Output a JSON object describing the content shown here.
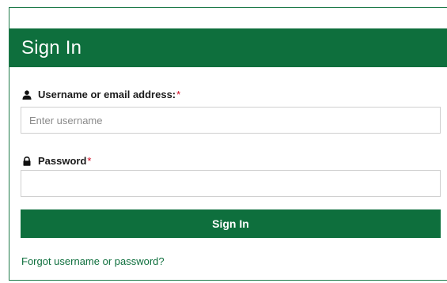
{
  "header": {
    "title": "Sign In"
  },
  "username": {
    "label": "Username or email address:",
    "required_marker": "*",
    "placeholder": "Enter username",
    "value": "",
    "icon": "user-icon"
  },
  "password": {
    "label": "Password",
    "required_marker": "*",
    "placeholder": "",
    "value": "",
    "icon": "lock-icon"
  },
  "actions": {
    "signin_label": "Sign In",
    "forgot_label": "Forgot username or password?"
  },
  "colors": {
    "brand_green": "#0e6f3d",
    "required_red": "#d0021b",
    "input_border": "#cfcfcf"
  }
}
